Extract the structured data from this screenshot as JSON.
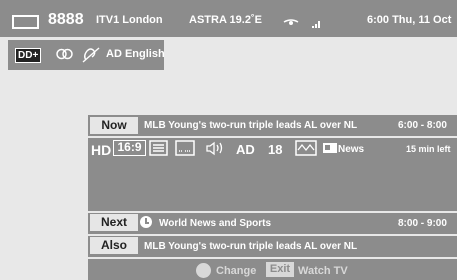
{
  "channel": {
    "number": "8888",
    "name": "ITV1 London",
    "satellite": "ASTRA 19.2˚E",
    "datetime": "6:00 Thu, 11 Oct"
  },
  "top_badges": {
    "dolby": "DD+",
    "audio_description": "AD English"
  },
  "now": {
    "label": "Now",
    "title": "MLB Young's two-run triple leads AL over NL",
    "time": "6:00 - 8:00",
    "time_left": "15 min left"
  },
  "feature_icons": {
    "hd": "HD",
    "aspect": "16:9",
    "ad": "AD",
    "age": "18",
    "genre": "News"
  },
  "next": {
    "label": "Next",
    "title": "World News and Sports",
    "time": "8:00 - 9:00"
  },
  "also": {
    "label": "Also",
    "title": "MLB Young's two-run triple leads AL over NL"
  },
  "footer": {
    "change_label": "Change",
    "exit_label": "Exit",
    "watch_label": "Watch TV"
  }
}
